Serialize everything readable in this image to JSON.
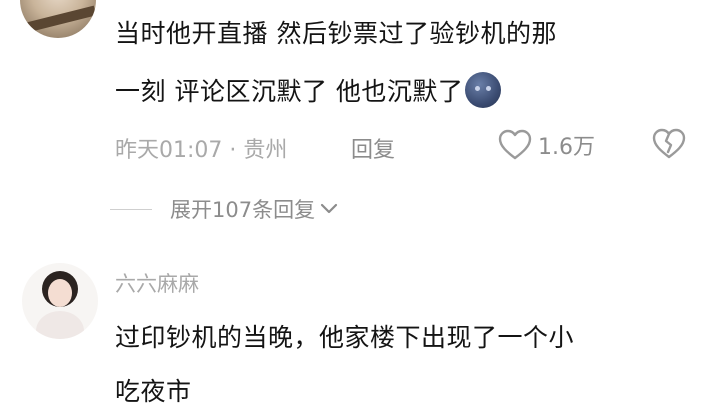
{
  "comments": [
    {
      "text_line1": "当时他开直播 然后钞票过了验钞机的那",
      "text_line2": "一刻 评论区沉默了 他也沉默了",
      "emoji": "dark-moon-face-emoji",
      "time_location": "昨天01:07 · 贵州",
      "reply_label": "回复",
      "like_count": "1.6万",
      "expand_replies_label": "展开107条回复"
    },
    {
      "username": "六六麻麻",
      "text_line1": "过印钞机的当晚，他家楼下出现了一个小",
      "text_line2": "吃夜市"
    }
  ],
  "icons": {
    "like": "heart-icon",
    "dislike": "broken-heart-icon",
    "expand": "chevron-down-icon"
  },
  "colors": {
    "text_primary": "#141414",
    "text_secondary": "#a9a9a9",
    "text_action": "#8c8c8c"
  }
}
